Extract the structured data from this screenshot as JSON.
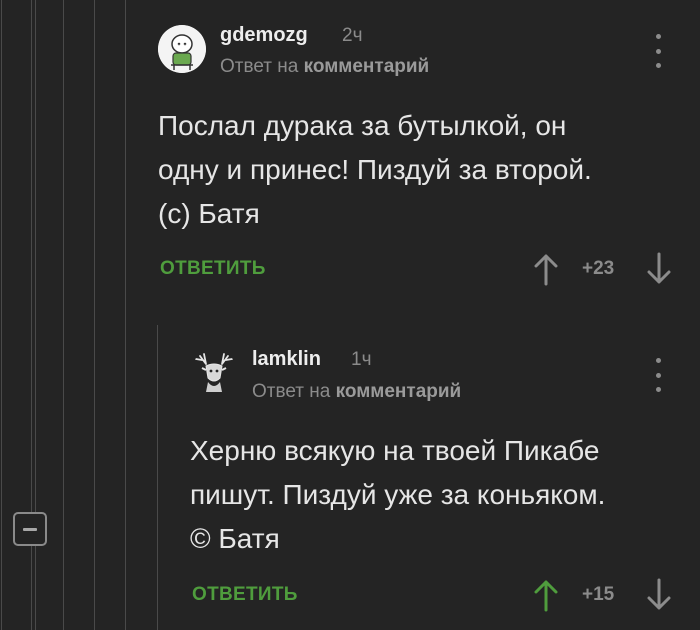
{
  "comments": [
    {
      "username": "gdemozg",
      "time": "2ч",
      "reply_prefix": "Ответ на",
      "reply_link": "комментарий",
      "lines": [
        "Послал дурака за бутылкой, он",
        "одну и принес! Пиздуй за второй.",
        "(с) Батя"
      ],
      "reply_label": "ОТВЕТИТЬ",
      "rating": "+23",
      "upvote_color": "#8c8c8c",
      "downvote_color": "#8c8c8c"
    },
    {
      "username": "lamklin",
      "time": "1ч",
      "reply_prefix": "Ответ на",
      "reply_link": "комментарий",
      "lines": [
        "Херню всякую на твоей Пикабе",
        "пишут. Пиздуй уже за коньяком.",
        "© Батя"
      ],
      "reply_label": "ОТВЕТИТЬ",
      "rating": "+15",
      "upvote_color": "#4f9d3d",
      "downvote_color": "#8c8c8c"
    }
  ],
  "colors": {
    "background": "#242424",
    "accent_green": "#4f9d3d",
    "muted": "#8b8b8b",
    "text": "#e6e6e6"
  },
  "icons": [
    "collapse-thread-icon",
    "kebab-menu-icon",
    "arrow-up-icon",
    "arrow-down-icon",
    "avatar"
  ]
}
